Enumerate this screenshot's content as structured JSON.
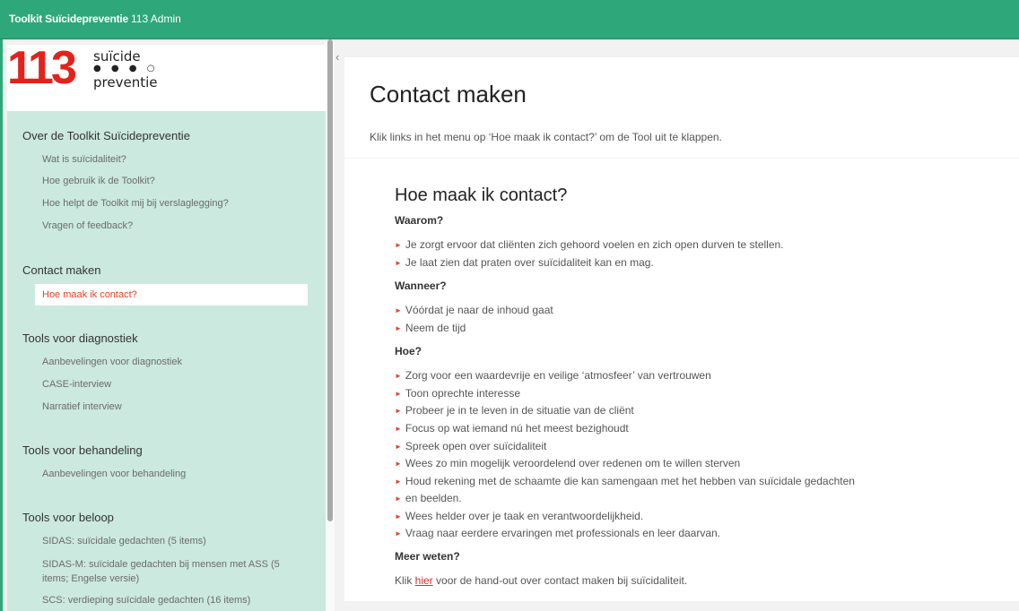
{
  "topbar": {
    "brand": "Toolkit Suïcidepreventie",
    "admin": "113 Admin"
  },
  "logo": {
    "number": "113",
    "word1": "suïcide",
    "dots": "● ● ● ○",
    "word2": "preventie"
  },
  "sidebar": {
    "sections": [
      {
        "title": "Over de Toolkit Suïcidepreventie",
        "items": [
          "Wat is suïcidaliteit?",
          "Hoe gebruik ik de Toolkit?",
          "Hoe helpt de Toolkit mij bij verslaglegging?",
          "Vragen of feedback?"
        ]
      },
      {
        "title": "Contact maken",
        "items": [
          "Hoe maak ik contact?"
        ]
      },
      {
        "title": "Tools voor diagnostiek",
        "items": [
          "Aanbevelingen voor diagnostiek",
          "CASE-interview",
          "Narratief interview"
        ]
      },
      {
        "title": "Tools voor behandeling",
        "items": [
          "Aanbevelingen voor behandeling"
        ]
      },
      {
        "title": "Tools voor beloop",
        "items": [
          "SIDAS: suïcidale gedachten (5 items)",
          "SIDAS-M: suïcidale gedachten bij mensen met ASS (5",
          "items; Engelse versie)",
          "SCS: verdieping suïcidale gedachten (16 items)"
        ]
      }
    ]
  },
  "collapse_icon": "‹",
  "header": {
    "title": "Contact maken",
    "intro": "Klik links in het menu op ‘Hoe maak ik contact?’ om de Tool uit te klappen."
  },
  "content": {
    "title": "Hoe maak ik contact?",
    "waarom_label": "Waarom?",
    "waarom": [
      "Je zorgt ervoor dat cliënten zich gehoord voelen en zich open durven te stellen.",
      "Je laat zien dat praten over suïcidaliteit kan en mag."
    ],
    "wanneer_label": "Wanneer?",
    "wanneer": [
      "Vóórdat je naar de inhoud gaat",
      "Neem de tijd"
    ],
    "hoe_label": "Hoe?",
    "hoe": [
      "Zorg voor een waardevrije en veilige ‘atmosfeer’ van vertrouwen",
      "Toon oprechte interesse",
      "Probeer je in te leven in de situatie van de cliënt",
      "Focus op wat iemand nú het meest bezighoudt",
      "Spreek open over suïcidaliteit",
      "Wees zo min mogelijk veroordelend over redenen om te willen sterven",
      "Houd rekening met de schaamte die kan samengaan met het hebben van suïcidale gedachten",
      "en beelden.",
      "Wees helder over je taak en verantwoordelijkheid.",
      "Vraag naar eerdere ervaringen met professionals en leer daarvan."
    ],
    "meer_label": "Meer weten?",
    "meer_prefix": "Klik ",
    "meer_link": "hier",
    "meer_suffix": " voor de hand-out over contact maken bij suïcidaliteit."
  },
  "bullet_icon": "►",
  "colors": {
    "brand_green": "#2ea77a",
    "sidebar_bg": "#cbe9de",
    "accent_red": "#e2432a"
  }
}
